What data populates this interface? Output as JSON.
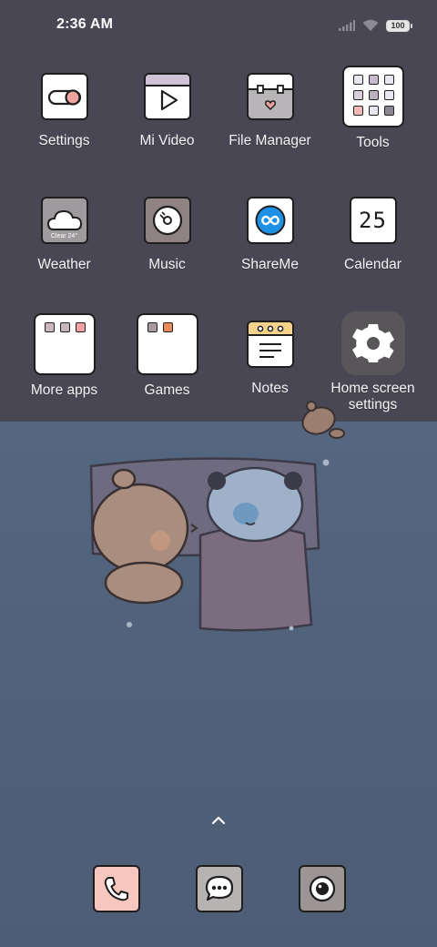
{
  "status_bar": {
    "time": "2:36 AM",
    "battery_level": "100",
    "icons": [
      "signal-icon",
      "wifi-icon",
      "battery-icon"
    ]
  },
  "apps": [
    {
      "name": "settings",
      "label": "Settings",
      "icon": "toggle-icon"
    },
    {
      "name": "mi-video",
      "label": "Mi Video",
      "icon": "play-icon"
    },
    {
      "name": "file-manager",
      "label": "File Manager",
      "icon": "folder-heart-icon"
    },
    {
      "name": "tools",
      "label": "Tools",
      "icon": "folder-icon"
    },
    {
      "name": "weather",
      "label": "Weather",
      "icon": "cloud-icon",
      "icon_text": "Clear 24°"
    },
    {
      "name": "music",
      "label": "Music",
      "icon": "disc-icon"
    },
    {
      "name": "shareme",
      "label": "ShareMe",
      "icon": "infinity-icon"
    },
    {
      "name": "calendar",
      "label": "Calendar",
      "icon": "calendar-icon",
      "icon_text": "25"
    },
    {
      "name": "more-apps",
      "label": "More apps",
      "icon": "folder-icon"
    },
    {
      "name": "games",
      "label": "Games",
      "icon": "folder-icon"
    },
    {
      "name": "notes",
      "label": "Notes",
      "icon": "notepad-icon"
    },
    {
      "name": "home-screen-settings",
      "label": "Home screen settings",
      "icon": "gear-icon"
    }
  ],
  "dock": [
    {
      "name": "phone",
      "icon": "phone-icon",
      "color": "#f6c6bf"
    },
    {
      "name": "messages",
      "icon": "chat-icon",
      "color": "#b7b3b3"
    },
    {
      "name": "camera",
      "icon": "camera-icon",
      "color": "#9c9596"
    }
  ],
  "colors": {
    "wallpaper_top": "#4a4754",
    "wallpaper_bottom": "#546680",
    "accent_blue": "#1e90e6",
    "accent_pink": "#f0a4a0"
  }
}
